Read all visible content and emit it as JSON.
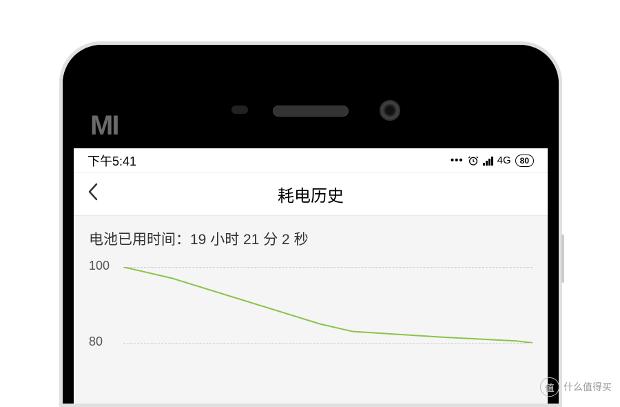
{
  "status_bar": {
    "time": "下午5:41",
    "network": "4G",
    "battery_percent": "80"
  },
  "nav": {
    "title": "耗电历史"
  },
  "content": {
    "usage_label": "电池已用时间：19 小时 21 分 2 秒"
  },
  "chart_data": {
    "type": "line",
    "title": "",
    "xlabel": "",
    "ylabel": "",
    "ylim": [
      80,
      100
    ],
    "y_ticks": [
      100,
      80
    ],
    "x": [
      0,
      0.12,
      0.3,
      0.48,
      0.56,
      0.78,
      0.96,
      1.0
    ],
    "values": [
      100,
      97,
      91,
      85,
      83,
      81.5,
      80.5,
      80
    ],
    "line_color": "#8bc34a"
  },
  "watermark": {
    "icon_text": "值",
    "text": "什么值得买"
  },
  "logo": {
    "text": "MI"
  }
}
